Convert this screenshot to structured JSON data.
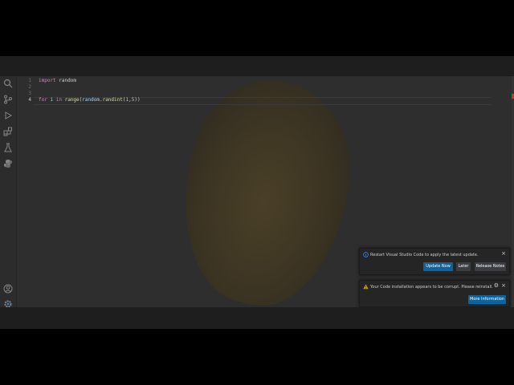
{
  "editor": {
    "lines": [
      {
        "number": "1",
        "tokens": [
          {
            "cls": "kw",
            "text": "import"
          },
          {
            "cls": "",
            "text": " random"
          }
        ]
      },
      {
        "number": "2",
        "tokens": []
      },
      {
        "number": "3",
        "tokens": []
      },
      {
        "number": "4",
        "tokens": [
          {
            "cls": "kw",
            "text": "for"
          },
          {
            "cls": "",
            "text": " "
          },
          {
            "cls": "var",
            "text": "i"
          },
          {
            "cls": "",
            "text": " "
          },
          {
            "cls": "kw",
            "text": "in"
          },
          {
            "cls": "",
            "text": " "
          },
          {
            "cls": "fn",
            "text": "range"
          },
          {
            "cls": "",
            "text": "("
          },
          {
            "cls": "var",
            "text": "random"
          },
          {
            "cls": "",
            "text": "."
          },
          {
            "cls": "fn",
            "text": "randint"
          },
          {
            "cls": "",
            "text": "("
          },
          {
            "cls": "num",
            "text": "1"
          },
          {
            "cls": "",
            "text": ","
          },
          {
            "cls": "num",
            "text": "5"
          },
          {
            "cls": "",
            "text": "))"
          }
        ]
      }
    ]
  },
  "activity_bar": {
    "icons": [
      "search-icon",
      "source-control-icon",
      "run-debug-icon",
      "extensions-icon",
      "testing-icon",
      "python-icon",
      "account-icon",
      "settings-gear-icon"
    ]
  },
  "notifications": {
    "update": {
      "message": "Restart Visual Studio Code to apply the latest update.",
      "buttons": {
        "update_now": "Update Now",
        "later": "Later",
        "release_notes": "Release Notes"
      }
    },
    "corrupt": {
      "message": "Your Code installation appears to be corrupt. Please reinstall.",
      "buttons": {
        "more_info": "More Information"
      }
    }
  },
  "colors": {
    "accent": "#0e639c",
    "info": "#3794ff",
    "warning": "#cca700"
  }
}
